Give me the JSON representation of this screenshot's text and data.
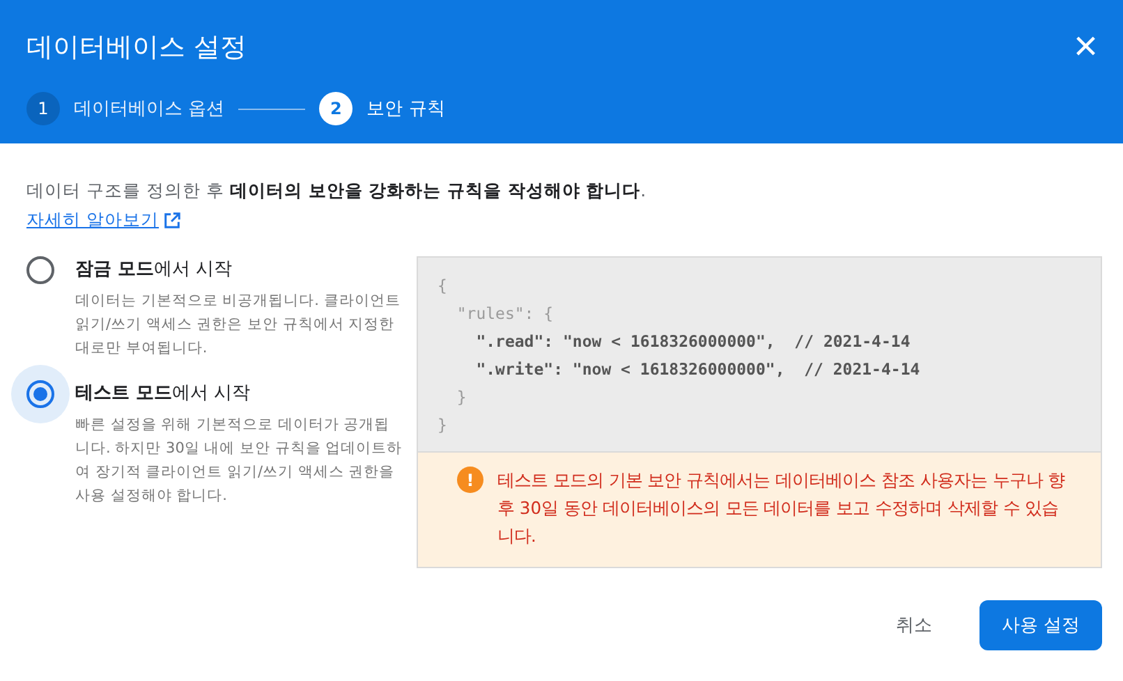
{
  "dialog": {
    "title": "데이터베이스 설정",
    "close": "×"
  },
  "steps": [
    {
      "number": "1",
      "label": "데이터베이스 옵션",
      "selected": false
    },
    {
      "number": "2",
      "label": "보안 규칙",
      "selected": true
    }
  ],
  "intro": "데이터 구조를 정의한 후 **데이터의 보안을 강화하는 규칙을 작성해야 합니다**.",
  "learn_more": "자세히 알아보기",
  "modes": [
    {
      "title": "**잠금 모드**에서 시작",
      "description": "데이터는 기본적으로 비공개됩니다. 클라이언트 읽기/쓰기 액세스 권한은 보안 규칙에서 지정한 대로만 부여됩니다.",
      "selected": false
    },
    {
      "title": "**테스트 모드**에서 시작",
      "description": "빠른 설정을 위해 기본적으로 데이터가 공개됩니다. 하지만 30일 내에 보안 규칙을 업데이트하여 장기적 클라이언트 읽기/쓰기 액세스 권한을 사용 설정해야 합니다.",
      "selected": true
    }
  ],
  "code": [
    {
      "text": "{",
      "highlighted": false
    },
    {
      "text": "  \"rules\": {",
      "highlighted": false
    },
    {
      "text": "    \".read\": \"now < 1618326000000\",  // 2021-4-14",
      "highlighted": true
    },
    {
      "text": "    \".write\": \"now < 1618326000000\",  // 2021-4-14",
      "highlighted": true
    },
    {
      "text": "  }",
      "highlighted": false
    },
    {
      "text": "}",
      "highlighted": false
    }
  ],
  "warning": {
    "icon": "!",
    "text": "테스트 모드의 기본 보안 규칙에서는 데이터베이스 참조 사용자는 누구나 향후 30일 동안 데이터베이스의 모든 데이터를 보고 수정하며 삭제할 수 있습니다."
  },
  "buttons": [
    {
      "label": "취소",
      "kind": "text"
    },
    {
      "label": "사용 설정",
      "kind": "primary"
    }
  ]
}
